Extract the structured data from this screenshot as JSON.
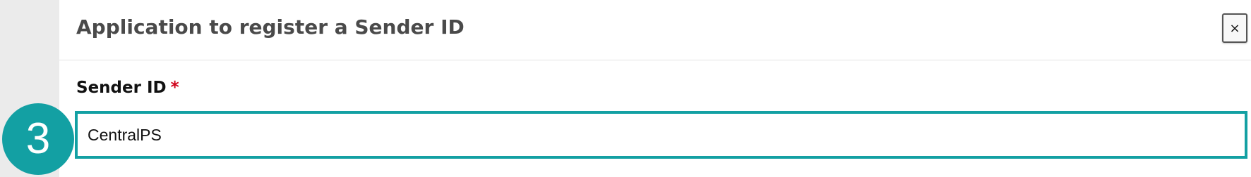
{
  "modal": {
    "title": "Application to register a Sender ID",
    "close_label": "×"
  },
  "form": {
    "sender_id": {
      "label": "Sender ID",
      "required_mark": "*",
      "value": "CentralPS"
    }
  },
  "annotation": {
    "step_number": "3"
  },
  "colors": {
    "accent": "#13a0a3",
    "required": "#d0021b",
    "title_text": "#4a4a4a"
  }
}
